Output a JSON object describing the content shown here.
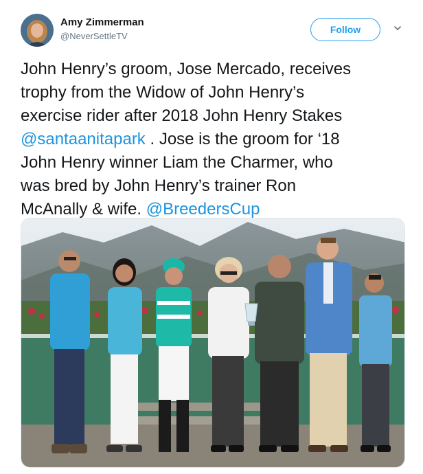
{
  "user": {
    "display_name": "Amy Zimmerman",
    "handle": "@NeverSettleTV",
    "avatar_icon": "profile-photo-avatar"
  },
  "actions": {
    "follow_label": "Follow",
    "more_icon": "chevron-down-icon"
  },
  "tweet": {
    "lines": [
      {
        "text": "John Henry’s groom, Jose Mercado, receives"
      },
      {
        "text": "trophy from the Widow of John Henry’s"
      },
      {
        "text": "exercise rider after 2018 John Henry Stakes"
      },
      {
        "mention": "@santaanitapark",
        "text": " . Jose is the groom for ‘18"
      },
      {
        "text": "John Henry winner Liam the Charmer, who"
      },
      {
        "text": "was bred by John Henry’s trainer Ron"
      },
      {
        "text": "McAnally & wife. ",
        "mention": "@BreedersCup"
      }
    ]
  },
  "colors": {
    "link": "#1b95e0",
    "follow_border": "#1da1f2",
    "secondary_text": "#657786",
    "primary_text": "#14171a"
  }
}
